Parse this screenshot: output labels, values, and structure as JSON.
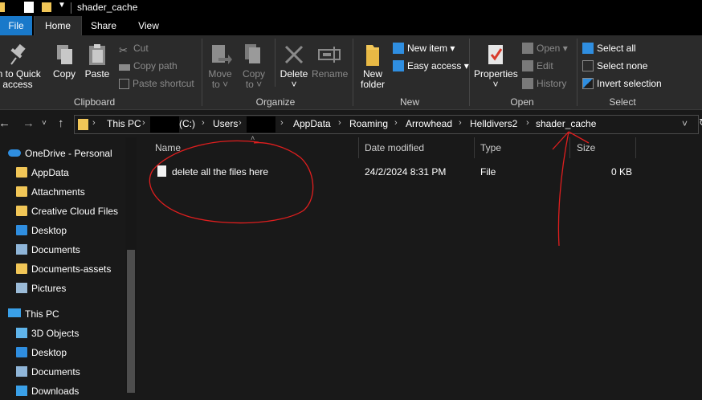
{
  "window": {
    "title": "shader_cache"
  },
  "tabs": [
    {
      "label": "File"
    },
    {
      "label": "Home"
    },
    {
      "label": "Share"
    },
    {
      "label": "View"
    }
  ],
  "ribbon": {
    "clipboard": {
      "group_label": "Clipboard",
      "pin_label_1": "in to Quick",
      "pin_label_2": "access",
      "copy": "Copy",
      "paste": "Paste",
      "cut": "Cut",
      "copy_path": "Copy path",
      "paste_shortcut": "Paste shortcut"
    },
    "organize": {
      "group_label": "Organize",
      "move_to_1": "Move",
      "move_to_2": "to",
      "copy_to_1": "Copy",
      "copy_to_2": "to",
      "delete": "Delete",
      "rename": "Rename"
    },
    "new": {
      "group_label": "New",
      "new_folder_1": "New",
      "new_folder_2": "folder",
      "new_item": "New item",
      "easy_access": "Easy access"
    },
    "open": {
      "group_label": "Open",
      "properties": "Properties",
      "open": "Open",
      "edit": "Edit",
      "history": "History"
    },
    "select": {
      "group_label": "Select",
      "select_all": "Select all",
      "select_none": "Select none",
      "invert_selection": "Invert selection"
    }
  },
  "address": {
    "crumbs": [
      "This PC",
      "(C:)",
      "Users",
      "AppData",
      "Roaming",
      "Arrowhead",
      "Helldivers2",
      "shader_cache"
    ]
  },
  "nav": {
    "items": [
      {
        "label": "OneDrive - Personal",
        "icon": "cloud-icon"
      },
      {
        "label": "AppData",
        "icon": "folder-icon"
      },
      {
        "label": "Attachments",
        "icon": "folder-icon"
      },
      {
        "label": "Creative Cloud Files",
        "icon": "folder-icon"
      },
      {
        "label": "Desktop",
        "icon": "desktop-icon"
      },
      {
        "label": "Documents",
        "icon": "documents-icon"
      },
      {
        "label": "Documents-assets",
        "icon": "folder-icon"
      },
      {
        "label": "Pictures",
        "icon": "pictures-icon"
      },
      {
        "label": "This PC",
        "icon": "computer-icon"
      },
      {
        "label": "3D Objects",
        "icon": "3d-objects-icon"
      },
      {
        "label": "Desktop",
        "icon": "desktop-icon"
      },
      {
        "label": "Documents",
        "icon": "documents-icon"
      },
      {
        "label": "Downloads",
        "icon": "downloads-icon"
      }
    ]
  },
  "filelist": {
    "columns": [
      "Name",
      "Date modified",
      "Type",
      "Size"
    ],
    "rows": [
      {
        "name": "delete all the files here",
        "date": "24/2/2024 8:31 PM",
        "type": "File",
        "size": "0 KB"
      }
    ]
  },
  "colors": {
    "file_tab": "#1979ca",
    "background": "#191919",
    "ribbon": "#2b2b2b",
    "annotation": "#e01e1e",
    "folder": "#f1c657"
  }
}
